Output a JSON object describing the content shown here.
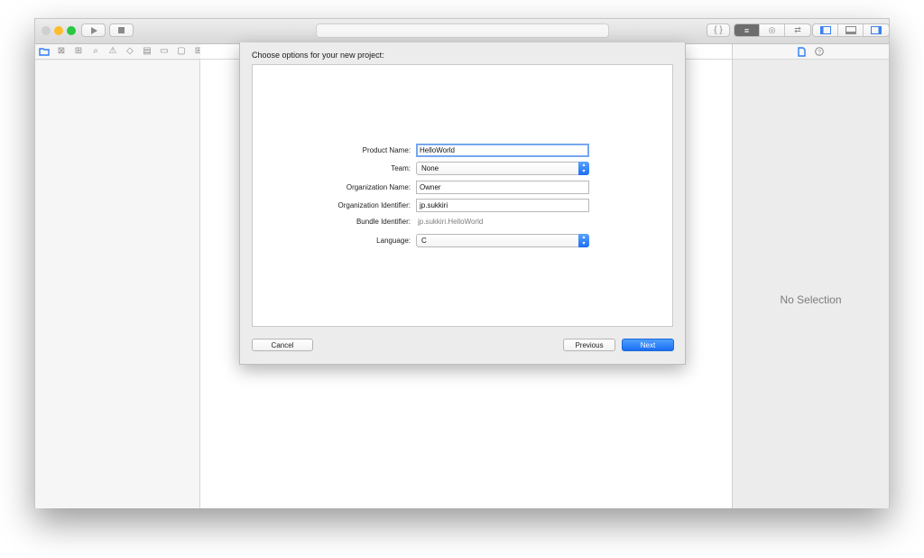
{
  "toolbar": {
    "run_icon": "play-icon",
    "stop_icon": "stop-icon",
    "standard_editor_icon": "standard-editor-icon",
    "assistant_editor_icon": "assistant-editor-icon",
    "version_editor_icon": "version-editor-icon"
  },
  "colors": {
    "accent": "#1a6ff3",
    "close": "#ff5f57",
    "minimize": "#febc2e",
    "zoom": "#28c840"
  },
  "dialog": {
    "title": "Choose options for your new project:",
    "fields": {
      "product_name": {
        "label": "Product Name:",
        "value": "HelloWorld"
      },
      "team": {
        "label": "Team:",
        "value": "None"
      },
      "organization_name": {
        "label": "Organization Name:",
        "value": "Owner"
      },
      "organization_identifier": {
        "label": "Organization Identifier:",
        "value": "jp.sukkiri"
      },
      "bundle_identifier": {
        "label": "Bundle Identifier:",
        "value": "jp.sukkiri.HelloWorld"
      },
      "language": {
        "label": "Language:",
        "value": "C"
      }
    },
    "buttons": {
      "cancel": "Cancel",
      "previous": "Previous",
      "next": "Next"
    }
  },
  "inspector": {
    "empty_text": "No Selection"
  }
}
